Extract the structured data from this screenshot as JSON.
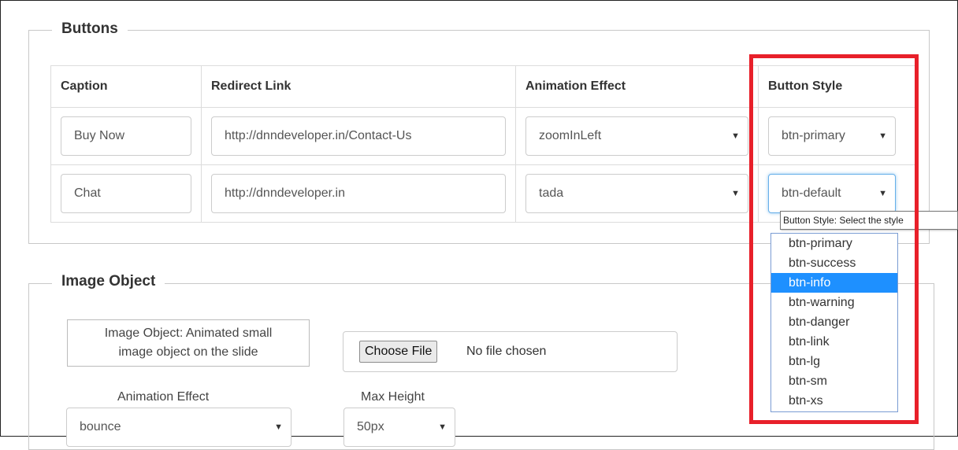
{
  "buttons_section": {
    "legend": "Buttons",
    "columns": [
      "Caption",
      "Redirect Link",
      "Animation Effect",
      "Button Style"
    ],
    "rows": [
      {
        "caption": "Buy Now",
        "link": "http://dnndeveloper.in/Contact-Us",
        "effect": "zoomInLeft",
        "style": "btn-primary"
      },
      {
        "caption": "Chat",
        "link": "http://dnndeveloper.in",
        "effect": "tada",
        "style": "btn-default"
      }
    ],
    "select_arrow": "▼"
  },
  "tooltip": "Button Style: Select the style",
  "style_dropdown": {
    "options": [
      "btn-primary",
      "btn-success",
      "btn-info",
      "btn-warning",
      "btn-danger",
      "btn-link",
      "btn-lg",
      "btn-sm",
      "btn-xs"
    ],
    "highlighted": "btn-info"
  },
  "image_section": {
    "legend": "Image Object",
    "description_line1": "Image Object: Animated small",
    "description_line2": "image object on the slide",
    "file_button": "Choose File",
    "file_status": "No file chosen",
    "animation_label": "Animation Effect",
    "animation_value": "bounce",
    "max_height_label": "Max Height",
    "max_height_value": "50px"
  },
  "colors": {
    "highlight_border": "#e8202a",
    "selected_option": "#1e90ff",
    "focus_border": "#66afe9"
  }
}
